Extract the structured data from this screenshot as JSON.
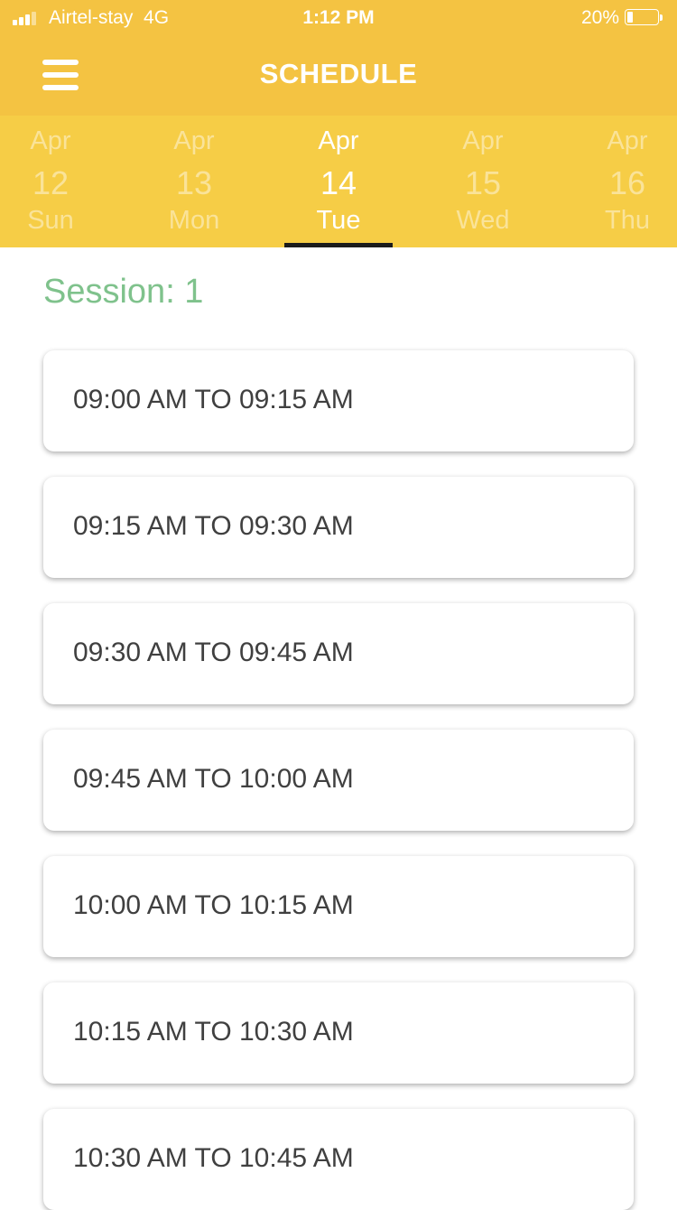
{
  "status_bar": {
    "carrier": "Airtel-stay",
    "network": "4G",
    "time": "1:12 PM",
    "battery": "20%",
    "battery_level": 0.2
  },
  "header": {
    "title": "SCHEDULE",
    "menu_icon": "hamburger-menu-icon"
  },
  "dates": [
    {
      "month": "Apr",
      "day": "12",
      "weekday": "Sun",
      "selected": false
    },
    {
      "month": "Apr",
      "day": "13",
      "weekday": "Mon",
      "selected": false
    },
    {
      "month": "Apr",
      "day": "14",
      "weekday": "Tue",
      "selected": true
    },
    {
      "month": "Apr",
      "day": "15",
      "weekday": "Wed",
      "selected": false
    },
    {
      "month": "Apr",
      "day": "16",
      "weekday": "Thu",
      "selected": false
    }
  ],
  "session": {
    "title": "Session: 1"
  },
  "slots": [
    "09:00 AM TO 09:15 AM",
    "09:15 AM TO 09:30 AM",
    "09:30 AM TO 09:45 AM",
    "09:45 AM TO 10:00 AM",
    "10:00 AM TO 10:15 AM",
    "10:15 AM TO 10:30 AM",
    "10:30 AM TO 10:45 AM"
  ],
  "colors": {
    "header_bg": "#f4c342",
    "datebar_bg": "#f6cd46",
    "session_text": "#7fc28c",
    "selected_indicator": "#1b1b1b"
  }
}
